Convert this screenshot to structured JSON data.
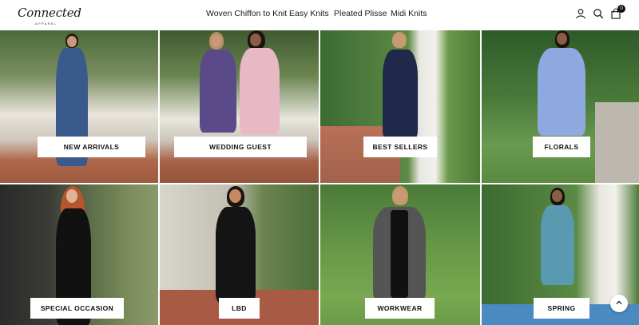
{
  "brand": {
    "logo_text": "Connected",
    "logo_subtext": "APPAREL"
  },
  "nav": {
    "items": [
      {
        "label": "Woven Chiffon to Knit"
      },
      {
        "label": "Easy Knits"
      },
      {
        "label": "Pleated Plisse"
      },
      {
        "label": "Midi Knits"
      }
    ]
  },
  "header_icons": {
    "account": "user-icon",
    "search": "search-icon",
    "cart": "shopping-bag-icon",
    "cart_count": "0"
  },
  "categories": [
    {
      "label": "NEW ARRIVALS",
      "dress_color": "#3b5a8c"
    },
    {
      "label": "WEDDING GUEST",
      "dress_color": "#5a4a8a"
    },
    {
      "label": "BEST SELLERS",
      "dress_color": "#1f2a4a"
    },
    {
      "label": "FLORALS",
      "dress_color": "#8fa8e0"
    },
    {
      "label": "SPECIAL OCCASION",
      "dress_color": "#111111"
    },
    {
      "label": "LBD",
      "dress_color": "#141414"
    },
    {
      "label": "WORKWEAR",
      "dress_color": "#555555"
    },
    {
      "label": "SPRING",
      "dress_color": "#5a9ab0"
    }
  ],
  "scroll_top_icon": "chevron-up-icon"
}
